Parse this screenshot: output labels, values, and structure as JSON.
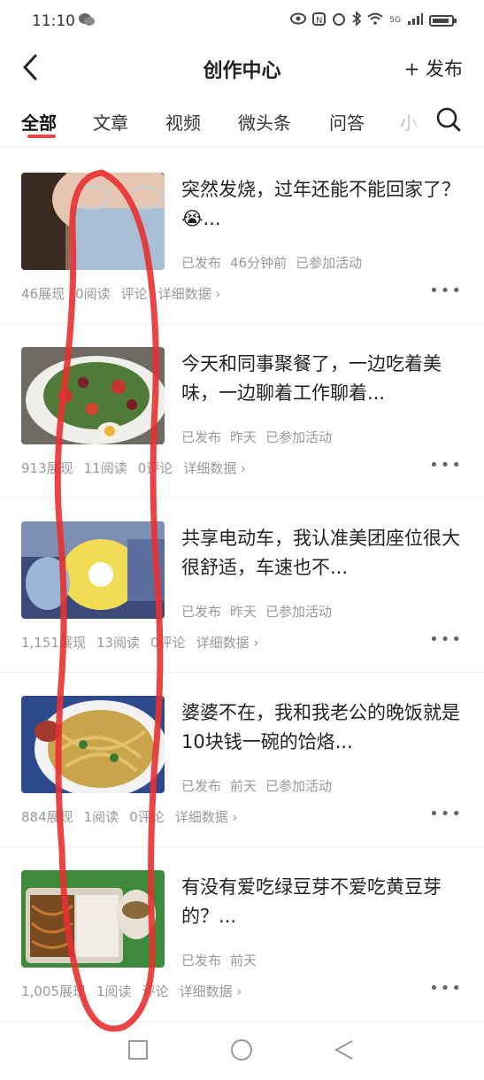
{
  "status": {
    "time": "11:10",
    "network": "5G"
  },
  "header": {
    "title": "创作中心",
    "publish": "+ 发布"
  },
  "tabs": [
    "全部",
    "文章",
    "视频",
    "微头条",
    "问答",
    "小"
  ],
  "posts": [
    {
      "title": "突然发烧，过年还能不能回家了？😭...",
      "status": "已发布",
      "time": "46分钟前",
      "activity": "已参加活动",
      "impressions": "46展现",
      "reads": "0阅读",
      "comments": "评论",
      "detail": "详细数据 ›"
    },
    {
      "title": "今天和同事聚餐了，一边吃着美味，一边聊着工作聊着...",
      "status": "已发布",
      "time": "昨天",
      "activity": "已参加活动",
      "impressions": "913展现",
      "reads": "11阅读",
      "comments": "0评论",
      "detail": "详细数据 ›"
    },
    {
      "title": "共享电动车，我认准美团座位很大很舒适，车速也不...",
      "status": "已发布",
      "time": "昨天",
      "activity": "已参加活动",
      "impressions": "1,151展现",
      "reads": "13阅读",
      "comments": "0评论",
      "detail": "详细数据 ›"
    },
    {
      "title": "婆婆不在，我和我老公的晚饭就是10块钱一碗的饸烙...",
      "status": "已发布",
      "time": "前天",
      "activity": "已参加活动",
      "impressions": "884展现",
      "reads": "1阅读",
      "comments": "0评论",
      "detail": "详细数据 ›"
    },
    {
      "title": "有没有爱吃绿豆芽不爱吃黄豆芽的？...",
      "status": "已发布",
      "time": "前天",
      "activity": "",
      "impressions": "1,005展现",
      "reads": "1阅读",
      "comments": "评论",
      "detail": "详细数据 ›"
    }
  ],
  "more_label": "•••",
  "colors": {
    "accent": "#e84545",
    "annotation": "#e83030"
  }
}
